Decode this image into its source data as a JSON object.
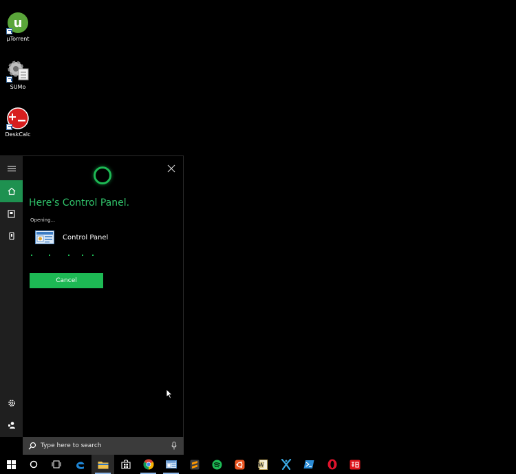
{
  "desktop": {
    "icons": [
      {
        "label": "μTorrent",
        "icon": "utorrent-icon"
      },
      {
        "label": "SUMo",
        "icon": "sumo-icon"
      },
      {
        "label": "DeskCalc",
        "icon": "deskcalc-icon"
      }
    ]
  },
  "cortana": {
    "rail": [
      "hamburger-icon",
      "home-icon",
      "notebook-icon",
      "devices-icon",
      "settings-icon",
      "feedback-icon"
    ],
    "headline": "Here's Control Panel.",
    "status": "Opening...",
    "result": {
      "label": "Control Panel",
      "icon": "control-panel-icon"
    },
    "cancel_label": "Cancel",
    "accent": "#1db954"
  },
  "search": {
    "placeholder": "Type here to search"
  },
  "taskbar": {
    "items": [
      "start-icon",
      "cortana-icon",
      "task-view-icon",
      "edge-icon",
      "file-explorer-icon",
      "store-icon",
      "chrome-icon",
      "control-panel-icon",
      "sublime-text-icon",
      "spotify-icon",
      "ubuntu-icon",
      "word-icon",
      "app-x-icon",
      "powershell-icon",
      "opera-icon",
      "youdao-icon"
    ]
  }
}
